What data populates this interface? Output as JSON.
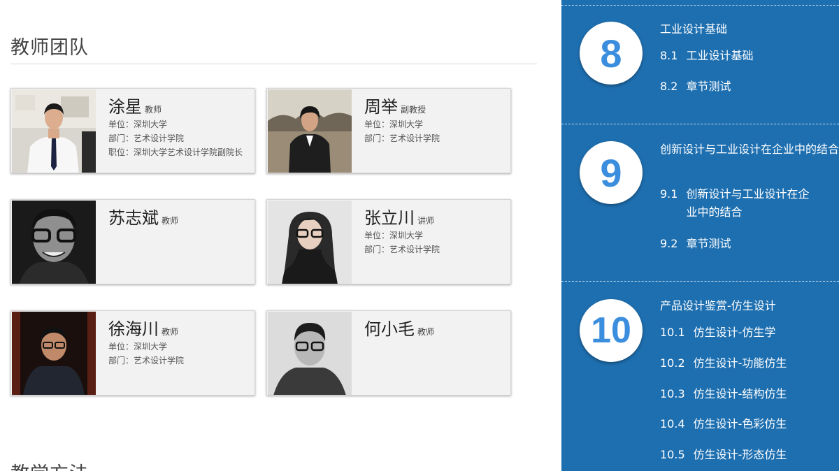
{
  "main": {
    "section_title": "教师团队",
    "next_section_title": "教学方法",
    "teachers": [
      {
        "name": "涂星",
        "role": "教师",
        "meta": [
          "单位：深圳大学",
          "部门：艺术设计学院",
          "职位：深圳大学艺术设计学院副院长"
        ]
      },
      {
        "name": "周举",
        "role": "副教授",
        "meta": [
          "单位：深圳大学",
          "部门：艺术设计学院"
        ]
      },
      {
        "name": "苏志斌",
        "role": "教师",
        "meta": []
      },
      {
        "name": "张立川",
        "role": "讲师",
        "meta": [
          "单位：深圳大学",
          "部门：艺术设计学院"
        ]
      },
      {
        "name": "徐海川",
        "role": "教师",
        "meta": [
          "单位：深圳大学",
          "部门：艺术设计学院"
        ]
      },
      {
        "name": "何小毛",
        "role": "教师",
        "meta": []
      }
    ]
  },
  "sidebar": {
    "chapters": [
      {
        "number": "8",
        "title": "工业设计基础",
        "lessons": [
          {
            "num": "8.1",
            "text": "工业设计基础"
          },
          {
            "num": "8.2",
            "text": "章节测试"
          }
        ]
      },
      {
        "number": "9",
        "title": "创新设计与工业设计在企业中的结合",
        "lessons": [
          {
            "num": "9.1",
            "text": "创新设计与工业设计在企业中的结合"
          },
          {
            "num": "9.2",
            "text": "章节测试"
          }
        ]
      },
      {
        "number": "10",
        "title": "产品设计鉴赏-仿生设计",
        "lessons": [
          {
            "num": "10.1",
            "text": "仿生设计-仿生学"
          },
          {
            "num": "10.2",
            "text": "仿生设计-功能仿生"
          },
          {
            "num": "10.3",
            "text": "仿生设计-结构仿生"
          },
          {
            "num": "10.4",
            "text": "仿生设计-色彩仿生"
          },
          {
            "num": "10.5",
            "text": "仿生设计-形态仿生"
          }
        ]
      }
    ]
  },
  "colors": {
    "sidebar_bg": "#1e6fb0",
    "chapter_number": "#3b8ede",
    "card_bg": "#f2f2f2"
  },
  "icons": [
    "teacher-photo"
  ]
}
